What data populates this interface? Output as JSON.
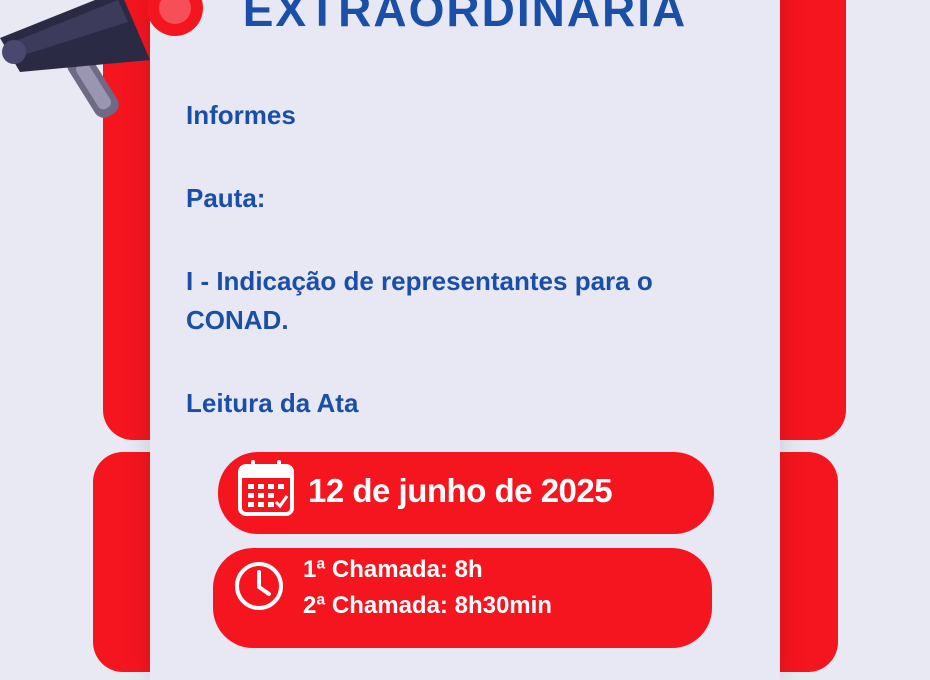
{
  "header": {
    "title": "EXTRAORDINÁRIA"
  },
  "agenda": {
    "informes": "Informes",
    "pauta": "Pauta:",
    "item_line1": "I - Indicação de representantes para o",
    "item_line2": "CONAD.",
    "leitura": "Leitura da Ata"
  },
  "date": {
    "text": "12 de junho de 2025",
    "icon": "calendar-icon"
  },
  "schedule": {
    "first_call": "1ª Chamada: 8h",
    "second_call": "2ª Chamada: 8h30min",
    "icon": "clock-icon"
  },
  "colors": {
    "accent": "#f5151f",
    "text_blue": "#1a4fa8",
    "background": "#e9e9f3"
  }
}
